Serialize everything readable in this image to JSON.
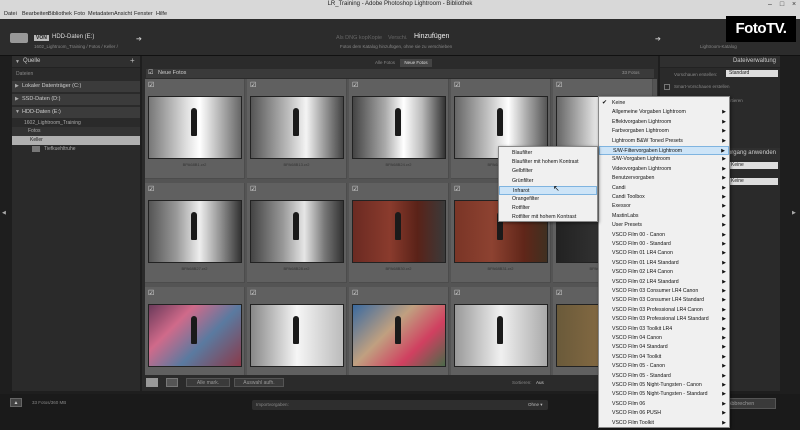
{
  "window": {
    "title": "LR_Training - Adobe Photoshop Lightroom - Bibliothek",
    "menu": [
      "Datei",
      "Bearbeiten",
      "Bibliothek",
      "Foto",
      "Metadaten",
      "Ansicht",
      "Fenster",
      "Hilfe"
    ]
  },
  "watermark": "FotoTV.",
  "import_header": {
    "source_tag": "VON",
    "source_value": "HDD-Daten (E:)",
    "source_path": "1602_Lightroom_Training / Fotos / Keller /",
    "modes": [
      "Als DNG kop.",
      "Kopie",
      "Verschi."
    ],
    "active_mode": "Hinzufügen",
    "mode_desc": "Fotos dem Katalog hinzufügen, ohne sie zu verschieben",
    "dest_label": "Lightroom-Katalog"
  },
  "left_panel": {
    "title": "Quelle",
    "add": "+",
    "files_label": "Dateien",
    "drives": [
      "Lokaler Datenträger (C:)",
      "SSD-Daten (D:)",
      "HDD-Daten (E:)"
    ],
    "tree": [
      "1602_Lightroom_Training",
      "Fotos",
      "Keller",
      "Tiefkuehltruhe"
    ]
  },
  "center": {
    "tabs": [
      "Alle Fotos",
      "Neue Fotos"
    ],
    "active_tab": "Neue Fotos",
    "group_label": "Neue Fotos",
    "count": "33 Fotos",
    "captions": [
      "BPA68B1.cr2",
      "BPA68B13.cr2",
      "BPA68B24.cr2",
      "BPA68B25.cr2",
      "BPA68B26.cr2",
      "BPA68B27.cr2",
      "BPA68B28.cr2",
      "BPA68B30.cr2",
      "BPA68B31.cr2",
      "BPA68B32.cr2",
      "",
      "",
      "",
      "",
      ""
    ],
    "toolbar": {
      "check_all": "Alle mark.",
      "uncheck_all": "Auswahl aufh.",
      "sort_label": "Sortieren:",
      "sort_value": "Aus"
    }
  },
  "right_panel": {
    "file_handling": "Dateiverwaltung",
    "preview_label": "Vorschauen erstellen:",
    "preview_value": "Standard",
    "smart_previews": "Smart-Vorschauen erstellen",
    "import_label": "Importieren",
    "section2": "Vorgang anwenden",
    "keine1": "Keine",
    "keine2": "Keine"
  },
  "bottom": {
    "summary": "33 Fotos/360 MB",
    "preset_label": "Importvorgaben:",
    "preset_value": "Ohne ▾",
    "cancel": "Abbrechen"
  },
  "menu_main": {
    "items": [
      {
        "label": "Keine",
        "checked": true,
        "sub": false
      },
      {
        "label": "Allgemeine Vorgaben Lightroom",
        "sub": true
      },
      {
        "label": "Effektvorgaben Lightroom",
        "sub": true
      },
      {
        "label": "Farbvorgaben Lightroom",
        "sub": true
      },
      {
        "label": "Lightroom B&W Toned Presets",
        "sub": true
      },
      {
        "label": "S/W-Filtervorgaben Lightroom",
        "sub": true,
        "hl": true
      },
      {
        "label": "S/W-Vorgaben Lightroom",
        "sub": true
      },
      {
        "label": "Videovorgaben Lightroom",
        "sub": true
      },
      {
        "label": "Benutzervorgaben",
        "sub": true
      },
      {
        "label": "Candi",
        "sub": true
      },
      {
        "label": "Candi Toolbox",
        "sub": true
      },
      {
        "label": "Exessor",
        "sub": true
      },
      {
        "label": "MastinLabs",
        "sub": true
      },
      {
        "label": "User Presets",
        "sub": true
      },
      {
        "label": "VSCO Film 00 - Canon",
        "sub": true
      },
      {
        "label": "VSCO Film 00 - Standard",
        "sub": true
      },
      {
        "label": "VSCO Film 01 LR4 Canon",
        "sub": true
      },
      {
        "label": "VSCO Film 01 LR4 Standard",
        "sub": true
      },
      {
        "label": "VSCO Film 02 LR4 Canon",
        "sub": true
      },
      {
        "label": "VSCO Film 02 LR4 Standard",
        "sub": true
      },
      {
        "label": "VSCO Film 03 Consumer LR4 Canon",
        "sub": true
      },
      {
        "label": "VSCO Film 03 Consumer LR4 Standard",
        "sub": true
      },
      {
        "label": "VSCO Film 03 Professional LR4 Canon",
        "sub": true
      },
      {
        "label": "VSCO Film 03 Professional LR4 Standard",
        "sub": true
      },
      {
        "label": "VSCO Film 03 Toolkit LR4",
        "sub": true
      },
      {
        "label": "VSCO Film 04 Canon",
        "sub": true
      },
      {
        "label": "VSCO Film 04 Standard",
        "sub": true
      },
      {
        "label": "VSCO Film 04 Toolkit",
        "sub": true
      },
      {
        "label": "VSCO Film 05 - Canon",
        "sub": true
      },
      {
        "label": "VSCO Film 05 - Standard",
        "sub": true
      },
      {
        "label": "VSCO Film 05 Night-Tungsten - Canon",
        "sub": true
      },
      {
        "label": "VSCO Film 05 Night-Tungsten - Standard",
        "sub": true
      },
      {
        "label": "VSCO Film 06",
        "sub": true
      },
      {
        "label": "VSCO Film 06 PUSH",
        "sub": true
      },
      {
        "label": "VSCO Film Toolkit",
        "sub": true
      }
    ]
  },
  "menu_sub": {
    "items": [
      {
        "label": "Blaufilter"
      },
      {
        "label": "Blaufilter mit hohem Kontrast"
      },
      {
        "label": "Gelbfilter"
      },
      {
        "label": "Grünfilter"
      },
      {
        "label": "Infrarot",
        "hl": true
      },
      {
        "label": "Orangefilter"
      },
      {
        "label": "Rotfilter"
      },
      {
        "label": "Rotfilter mit hohem Kontrast"
      }
    ]
  }
}
